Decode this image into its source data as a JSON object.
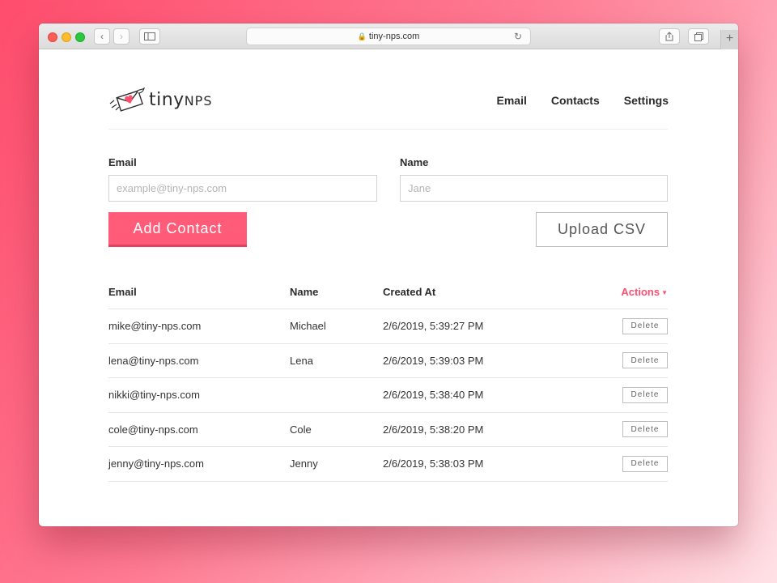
{
  "browser": {
    "url": "tiny-nps.com",
    "new_tab": "+"
  },
  "brand": {
    "name_primary": "tiny",
    "name_secondary": "NPS",
    "accent_color": "#ff5c79"
  },
  "nav": {
    "items": [
      {
        "label": "Email"
      },
      {
        "label": "Contacts"
      },
      {
        "label": "Settings"
      }
    ]
  },
  "form": {
    "email_label": "Email",
    "email_placeholder": "example@tiny-nps.com",
    "name_label": "Name",
    "name_placeholder": "Jane",
    "add_button": "Add Contact",
    "upload_button": "Upload CSV"
  },
  "table": {
    "headers": {
      "email": "Email",
      "name": "Name",
      "created_at": "Created At",
      "actions": "Actions"
    },
    "delete_label": "Delete",
    "rows": [
      {
        "email": "mike@tiny-nps.com",
        "name": "Michael",
        "created_at": "2/6/2019, 5:39:27 PM"
      },
      {
        "email": "lena@tiny-nps.com",
        "name": "Lena",
        "created_at": "2/6/2019, 5:39:03 PM"
      },
      {
        "email": "nikki@tiny-nps.com",
        "name": "",
        "created_at": "2/6/2019, 5:38:40 PM"
      },
      {
        "email": "cole@tiny-nps.com",
        "name": "Cole",
        "created_at": "2/6/2019, 5:38:20 PM"
      },
      {
        "email": "jenny@tiny-nps.com",
        "name": "Jenny",
        "created_at": "2/6/2019, 5:38:03 PM"
      }
    ]
  }
}
